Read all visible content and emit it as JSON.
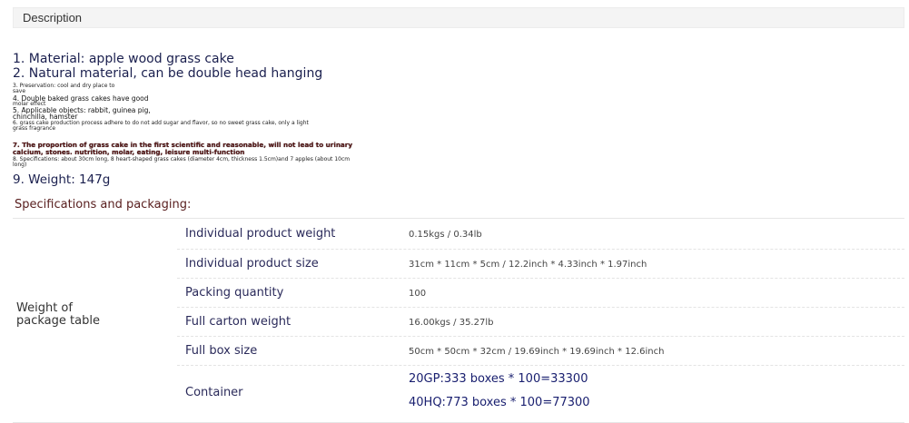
{
  "description_tab": {
    "label": "Description"
  },
  "features": {
    "line1": "1. Material: apple wood grass cake",
    "line2": "2. Natural material, can be double head hanging",
    "line3a": "3. Preservation: cool and dry place to",
    "line3b": "save",
    "line4a": "4. Double baked grass cakes have good",
    "line4b": "molar effect",
    "line5a": "5. Applicable objects: rabbit, guinea pig,",
    "line5b": "chinchilla, hamster",
    "line6a": "6. grass cake production process adhere to do not add sugar and flavor, so no sweet grass cake, only a light",
    "line6b": "grass fragrance",
    "line7a": "7. The proportion of grass cake in the first scientific and reasonable, will not lead to urinary",
    "line7b": "calcium, stones. nutrition, molar, eating, leisure multi-function",
    "line8a": "8. Specifications: about 30cm long, 8 heart-shaped grass cakes (diameter 4cm, thickness 1.5cm)and 7 apples (about 10cm",
    "line8b": "long)",
    "line9": "9. Weight: 147g"
  },
  "specs": {
    "heading": "Specifications and packaging:",
    "group_label": "Weight of package table",
    "rows": [
      {
        "label": "Individual product weight",
        "value": "0.15kgs / 0.34lb"
      },
      {
        "label": "Individual product size",
        "value": "31cm * 11cm * 5cm / 12.2inch * 4.33inch * 1.97inch"
      },
      {
        "label": "Packing quantity",
        "value": "100"
      },
      {
        "label": "Full carton weight",
        "value": "16.00kgs / 35.27lb"
      },
      {
        "label": "Full box size",
        "value": "50cm * 50cm * 32cm / 19.69inch * 19.69inch * 12.6inch"
      },
      {
        "label": "Container",
        "value1": "20GP:333 boxes * 100=33300",
        "value2": "40HQ:773 boxes * 100=77300"
      }
    ]
  }
}
